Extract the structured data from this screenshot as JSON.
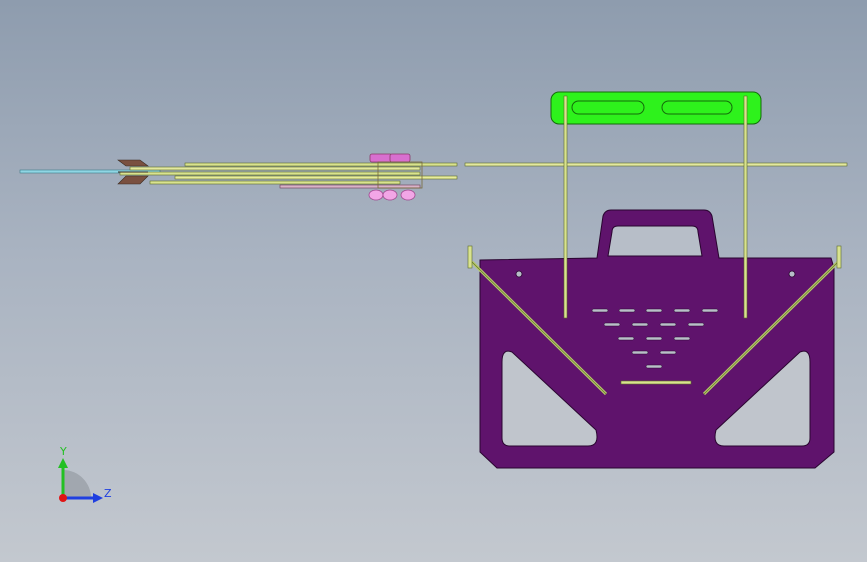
{
  "viewport": {
    "background_top": "#8e9cae",
    "background_bottom": "#c3c8cf"
  },
  "triad": {
    "y_label": "Y",
    "z_label": "Z",
    "y_color": "#23c023",
    "z_color": "#1f3fe0",
    "x_color": "#e01414"
  },
  "colors": {
    "plate": "#5f136c",
    "handle_bar": "#2ef21c",
    "rod": "#c9d98c",
    "rod_edge": "#5b6a28",
    "side_rod": "#b7c96a",
    "knob": "#d86fcf",
    "knob_dark": "#8a3a6a",
    "shaft_blue": "#8fd6e4",
    "arrow_head": "#7a5040"
  }
}
